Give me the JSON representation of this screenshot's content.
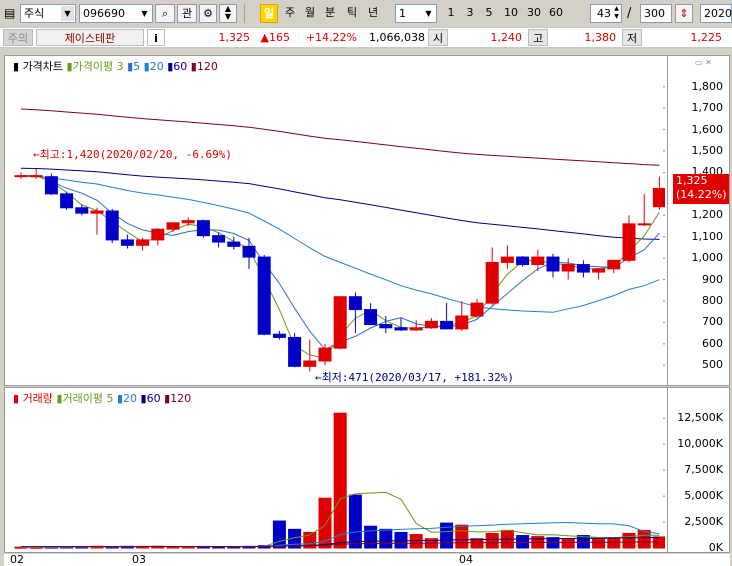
{
  "toolbar": {
    "market": "주식",
    "code": "096690",
    "btn_gwan": "관",
    "period_active": "일",
    "periods": [
      "주",
      "월",
      "분",
      "틱",
      "년"
    ],
    "interval": "1",
    "quick": [
      "1",
      "3",
      "5",
      "10",
      "30",
      "60"
    ],
    "count_current": "43",
    "count_sep": "/",
    "count_total": "300",
    "date_partial": "2020/"
  },
  "info": {
    "tag": "주의",
    "name": "제이스테판",
    "info_btn": "i",
    "price": "1,325",
    "change": "▲165",
    "change_pct": "+14.22%",
    "volume": "1,066,038",
    "open_label": "시",
    "open": "1,240",
    "high_label": "고",
    "high": "1,380",
    "low_label": "저",
    "low": "1,225"
  },
  "price_panel": {
    "legend_title": "가격차트",
    "legend_ma": "가격이평",
    "legend_periods": [
      "3",
      "5",
      "20",
      "60",
      "120"
    ],
    "y_ticks": [
      "1,800",
      "1,700",
      "1,600",
      "1,500",
      "1,400",
      "1,300",
      "1,200",
      "1,100",
      "1,000",
      "900",
      "800",
      "700",
      "600",
      "500"
    ],
    "current_price": "1,325",
    "current_pct": "(14.22%)",
    "annotation_high": "←최고:1,420(2020/02/20, -6.69%)",
    "annotation_low": "←최저:471(2020/03/17, +181.32%)"
  },
  "volume_panel": {
    "legend_title": "거래량",
    "legend_ma": "거래이평",
    "legend_periods": [
      "5",
      "20",
      "60",
      "120"
    ],
    "y_ticks": [
      "12,500K",
      "10,000K",
      "7,500K",
      "5,000K",
      "2,500K",
      "0K"
    ]
  },
  "x_axis": {
    "labels": [
      "02",
      "03",
      "04"
    ]
  },
  "colors": {
    "up": "#e00000",
    "down": "#0000c8",
    "ma3": "#6a9a1a",
    "ma5": "#2a6cd0",
    "ma20": "#2080d0",
    "ma60": "#000080",
    "ma120": "#800020"
  },
  "chart_data": {
    "type": "candlestick",
    "x": [
      "2020/02/14",
      "2020/02/17",
      "2020/02/18",
      "2020/02/19",
      "2020/02/20",
      "2020/02/21",
      "2020/02/24",
      "2020/02/25",
      "2020/02/26",
      "2020/02/27",
      "2020/02/28",
      "2020/03/02",
      "2020/03/03",
      "2020/03/04",
      "2020/03/05",
      "2020/03/06",
      "2020/03/09",
      "2020/03/10",
      "2020/03/11",
      "2020/03/12",
      "2020/03/13",
      "2020/03/16",
      "2020/03/17",
      "2020/03/18",
      "2020/03/19",
      "2020/03/20",
      "2020/03/23",
      "2020/03/24",
      "2020/03/25",
      "2020/03/26",
      "2020/03/27",
      "2020/03/30",
      "2020/03/31",
      "2020/04/01",
      "2020/04/02",
      "2020/04/03",
      "2020/04/06",
      "2020/04/07",
      "2020/04/08",
      "2020/04/09",
      "2020/04/10",
      "2020/04/13",
      "2020/04/14"
    ],
    "series": [
      {
        "name": "open",
        "values": [
          1385,
          1385,
          1380,
          1300,
          1235,
          1210,
          1220,
          1085,
          1060,
          1085,
          1135,
          1165,
          1175,
          1105,
          1075,
          1055,
          1005,
          645,
          630,
          495,
          520,
          580,
          820,
          760,
          690,
          675,
          665,
          675,
          705,
          670,
          730,
          790,
          980,
          1005,
          970,
          1005,
          940,
          970,
          935,
          950,
          990,
          1160,
          1240
        ]
      },
      {
        "name": "high",
        "values": [
          1400,
          1420,
          1395,
          1310,
          1250,
          1235,
          1230,
          1110,
          1095,
          1140,
          1165,
          1190,
          1180,
          1120,
          1100,
          1095,
          1015,
          660,
          650,
          620,
          600,
          700,
          840,
          790,
          730,
          720,
          710,
          720,
          790,
          800,
          810,
          1050,
          1060,
          1010,
          1040,
          1020,
          1000,
          990,
          950,
          980,
          1200,
          1300,
          1380
        ]
      },
      {
        "name": "low",
        "values": [
          1370,
          1370,
          1295,
          1225,
          1200,
          1110,
          1070,
          1045,
          1035,
          1060,
          1120,
          1150,
          1095,
          1050,
          1040,
          950,
          640,
          620,
          490,
          471,
          500,
          575,
          650,
          690,
          650,
          660,
          660,
          670,
          690,
          660,
          720,
          780,
          950,
          960,
          940,
          910,
          900,
          910,
          900,
          930,
          980,
          1150,
          1225
        ]
      },
      {
        "name": "close",
        "values": [
          1385,
          1385,
          1300,
          1235,
          1210,
          1220,
          1085,
          1060,
          1085,
          1135,
          1165,
          1175,
          1105,
          1075,
          1055,
          1005,
          645,
          630,
          495,
          520,
          580,
          820,
          760,
          690,
          675,
          665,
          675,
          705,
          670,
          730,
          790,
          980,
          1005,
          970,
          1005,
          940,
          970,
          935,
          950,
          990,
          1160,
          1160,
          1325
        ]
      },
      {
        "name": "volume",
        "values": [
          80,
          70,
          90,
          120,
          150,
          170,
          140,
          160,
          150,
          170,
          120,
          140,
          150,
          130,
          130,
          160,
          220,
          2600,
          1800,
          1500,
          4800,
          13000,
          5100,
          2100,
          1800,
          1500,
          1300,
          900,
          2400,
          2200,
          900,
          1400,
          1700,
          1200,
          1100,
          1000,
          900,
          1200,
          900,
          1000,
          1400,
          1700,
          1066
        ]
      }
    ],
    "ylim_price": [
      450,
      1850
    ],
    "ylim_volume": [
      0,
      13500000
    ]
  }
}
